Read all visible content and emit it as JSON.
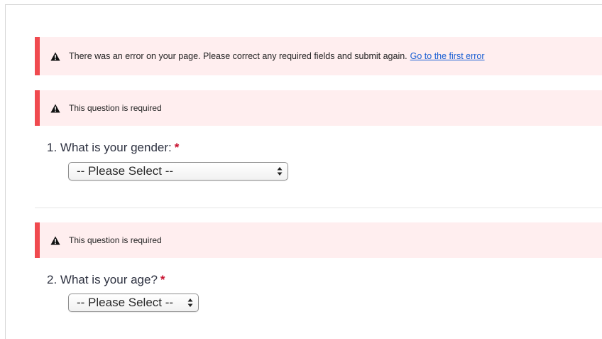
{
  "page_error": {
    "icon": "warning-icon",
    "message": "There was an error on your page. Please correct any required fields and submit again.",
    "link_text": "Go to the first error"
  },
  "questions": [
    {
      "error": "This question is required",
      "number_label": "1. What is your gender:",
      "required_marker": "*",
      "select_value": "-- Please Select --"
    },
    {
      "error": "This question is required",
      "number_label": "2. What is your age?",
      "required_marker": "*",
      "select_value": "-- Please Select --"
    }
  ],
  "colors": {
    "alert_background": "#ffeeef",
    "alert_border": "#f04a4f",
    "link": "#1a5fd3",
    "required_star": "#c8102e"
  }
}
